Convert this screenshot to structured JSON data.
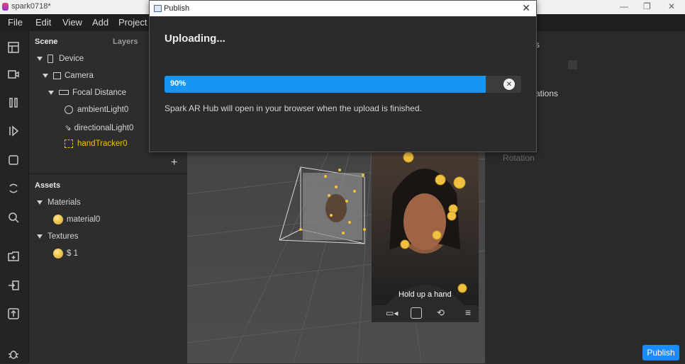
{
  "window": {
    "title": "spark0718*"
  },
  "menu": [
    "File",
    "Edit",
    "View",
    "Add",
    "Project"
  ],
  "scene_panel": {
    "tabs": [
      "Scene",
      "Layers"
    ],
    "tree": [
      {
        "label": "Device",
        "icon": "device-icon"
      },
      {
        "label": "Camera",
        "icon": "camera-icon"
      },
      {
        "label": "Focal Distance",
        "icon": "focal-distance-icon"
      },
      {
        "label": "ambientLight0",
        "icon": "globe-icon"
      },
      {
        "label": "directionalLight0",
        "icon": "directional-light-icon"
      },
      {
        "label": "handTracker0",
        "icon": "hand-tracker-icon"
      }
    ],
    "add_label": "+"
  },
  "assets_panel": {
    "title": "Assets",
    "groups": [
      {
        "label": "Materials",
        "items": [
          "material0"
        ]
      },
      {
        "label": "Textures",
        "items": [
          "$ 1"
        ]
      }
    ]
  },
  "right_panel": {
    "partial_s": "s",
    "animations_partial": "ations",
    "rotation_label": "Rotation"
  },
  "simulator": {
    "caption": "Hold up a hand"
  },
  "publish_button": "Publish",
  "dialog": {
    "title": "Publish",
    "heading": "Uploading...",
    "progress": 0.9,
    "progress_label": "90%",
    "note": "Spark AR Hub will open in your browser when the upload is finished."
  },
  "colors": {
    "accent": "#1596f5",
    "selected": "#f2c200"
  }
}
